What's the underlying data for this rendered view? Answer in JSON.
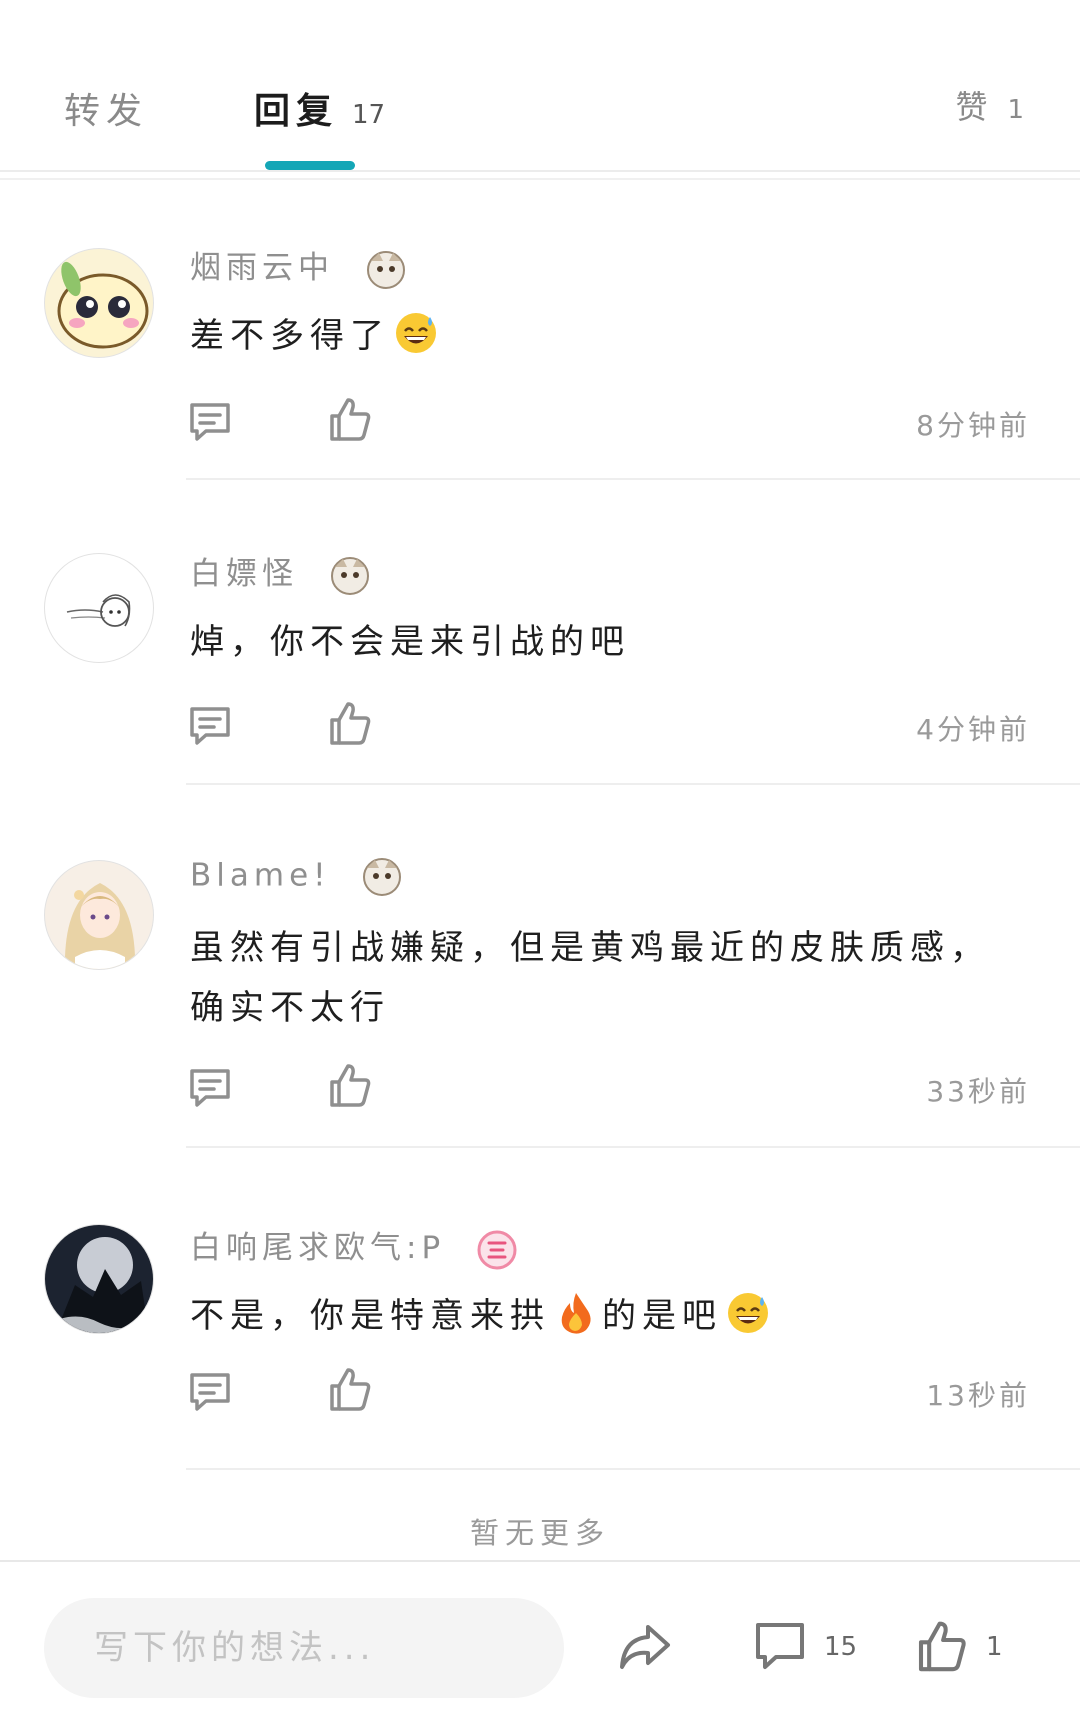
{
  "tabs": [
    {
      "label": "转发",
      "count": ""
    },
    {
      "label": "回复",
      "count": "17"
    },
    {
      "label": "赞",
      "count": "1"
    }
  ],
  "comments": [
    {
      "username": "烟雨云中",
      "text": "差不多得了",
      "trailing_emoji": "grinning-sweat-emoji",
      "time": "8分钟前"
    },
    {
      "username": "白嫖怪",
      "text": "焯，你不会是来引战的吧",
      "time": "4分钟前"
    },
    {
      "username": "Blame!",
      "text_line1": "虽然有引战嫌疑，但是黄鸡最近的皮肤质感，",
      "text_line2": "确实不太行",
      "time": "33秒前"
    },
    {
      "username": "白响尾求欧气:P",
      "text_part1": "不是，你是特意来拱",
      "inline_emoji": "fire-emoji",
      "text_part2": "的是吧",
      "trailing_emoji": "grinning-sweat-emoji",
      "time": "13秒前"
    }
  ],
  "footer_note": "暂无更多",
  "bottom_bar": {
    "input_placeholder": "写下你的想法...",
    "comment_count": "15",
    "like_count": "1"
  },
  "colors": {
    "accent": "#14a6b6",
    "secondary_text": "#8f8f8f"
  }
}
